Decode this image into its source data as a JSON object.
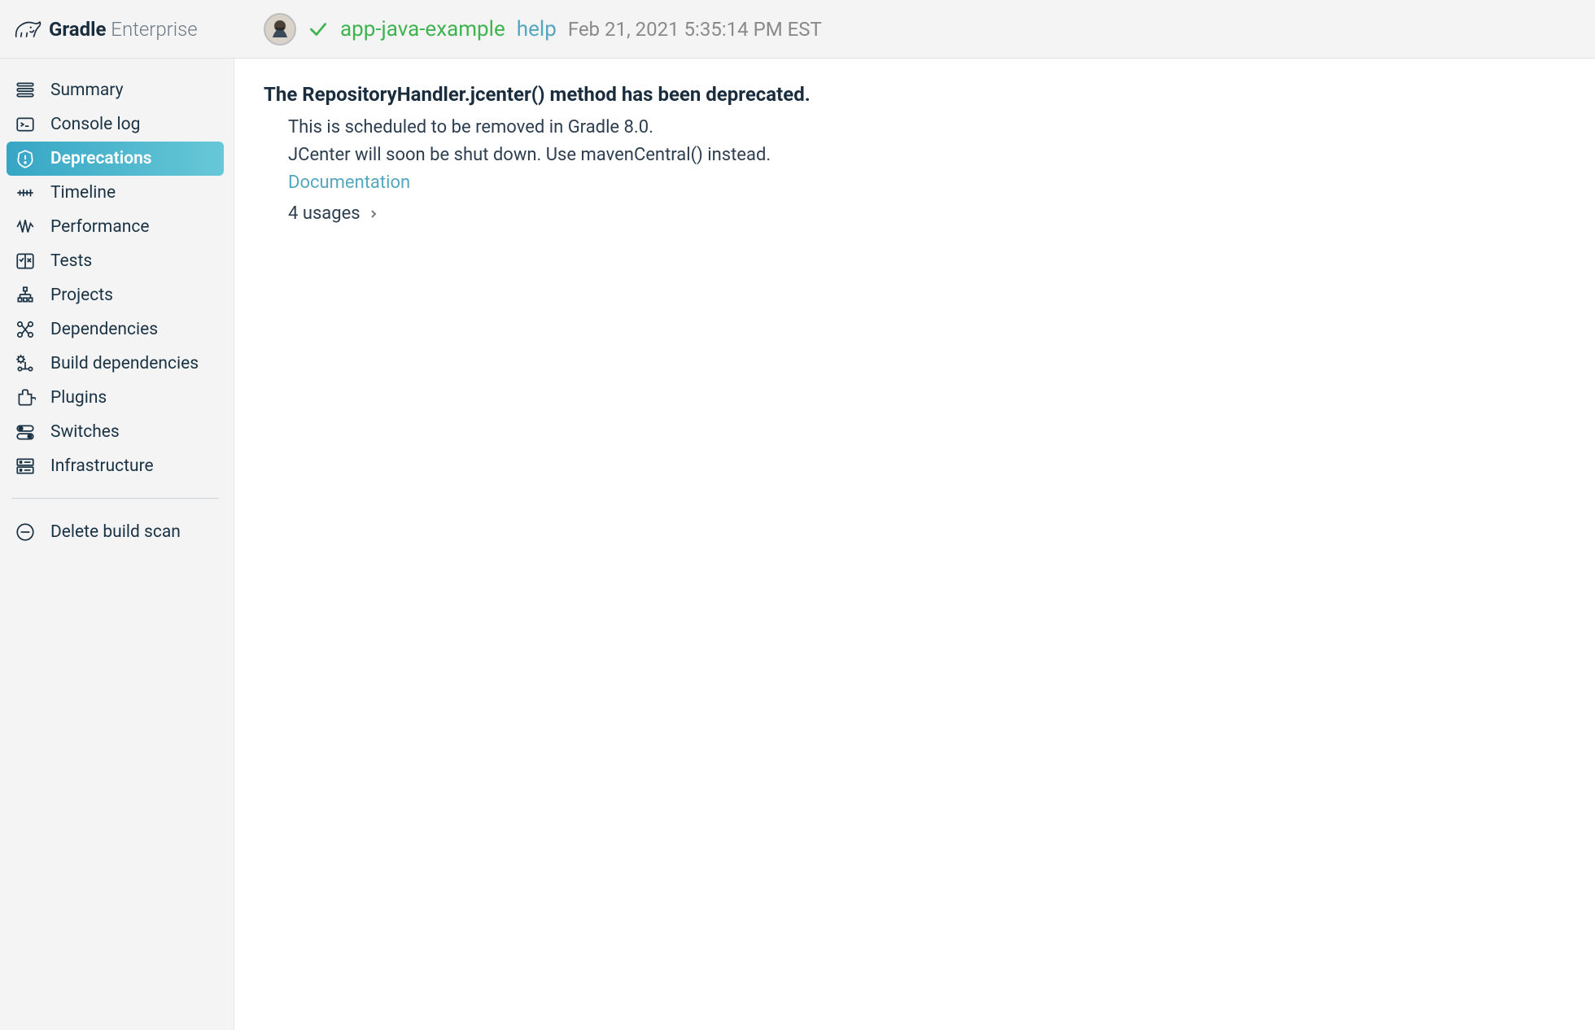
{
  "brand": {
    "bold": "Gradle",
    "light": " Enterprise"
  },
  "header": {
    "app_title": "app-java-example",
    "task_name": "help",
    "timestamp": "Feb 21, 2021 5:35:14 PM EST"
  },
  "sidebar": {
    "items": [
      {
        "id": "summary",
        "label": "Summary",
        "active": false
      },
      {
        "id": "console-log",
        "label": "Console log",
        "active": false
      },
      {
        "id": "deprecations",
        "label": "Deprecations",
        "active": true
      },
      {
        "id": "timeline",
        "label": "Timeline",
        "active": false
      },
      {
        "id": "performance",
        "label": "Performance",
        "active": false
      },
      {
        "id": "tests",
        "label": "Tests",
        "active": false
      },
      {
        "id": "projects",
        "label": "Projects",
        "active": false
      },
      {
        "id": "dependencies",
        "label": "Dependencies",
        "active": false
      },
      {
        "id": "build-dependencies",
        "label": "Build dependencies",
        "active": false
      },
      {
        "id": "plugins",
        "label": "Plugins",
        "active": false
      },
      {
        "id": "switches",
        "label": "Switches",
        "active": false
      },
      {
        "id": "infrastructure",
        "label": "Infrastructure",
        "active": false
      }
    ],
    "delete_label": "Delete build scan"
  },
  "main": {
    "deprecation": {
      "title": "The RepositoryHandler.jcenter() method has been deprecated.",
      "line1": "This is scheduled to be removed in Gradle 8.0.",
      "line2": "JCenter will soon be shut down. Use mavenCentral() instead.",
      "doc_link": "Documentation",
      "usages_label": "4 usages"
    }
  },
  "colors": {
    "accent_green": "#3fb34f",
    "accent_teal": "#55a6bf",
    "sidebar_active_start": "#36a6c5",
    "sidebar_active_end": "#67c8d7"
  }
}
